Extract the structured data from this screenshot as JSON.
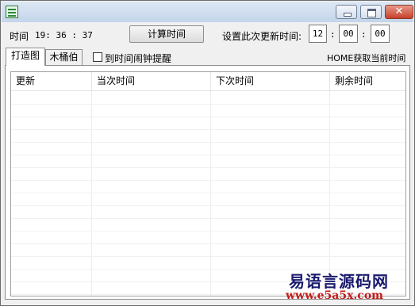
{
  "window": {
    "close_glyph": "✕"
  },
  "toolbar": {
    "time_label": "时间",
    "time_value": "19: 36 : 37",
    "calc_button": "计算时间",
    "set_next_label": "设置此次更新时间:",
    "hour": "12",
    "minute": "00",
    "second": "00",
    "sep": ":"
  },
  "tabs": [
    {
      "label": "打造图",
      "active": true
    },
    {
      "label": "木桶伯",
      "active": false
    }
  ],
  "alarm_checkbox_label": "到时间闹钟提醒",
  "home_hint": "HOME获取当前时间",
  "table": {
    "columns": [
      "更新",
      "当次时间",
      "下次时间",
      "剩余时间"
    ],
    "rows": []
  },
  "watermark": {
    "line1": "易语言源码网",
    "line2": "www.e5a5x.com"
  }
}
